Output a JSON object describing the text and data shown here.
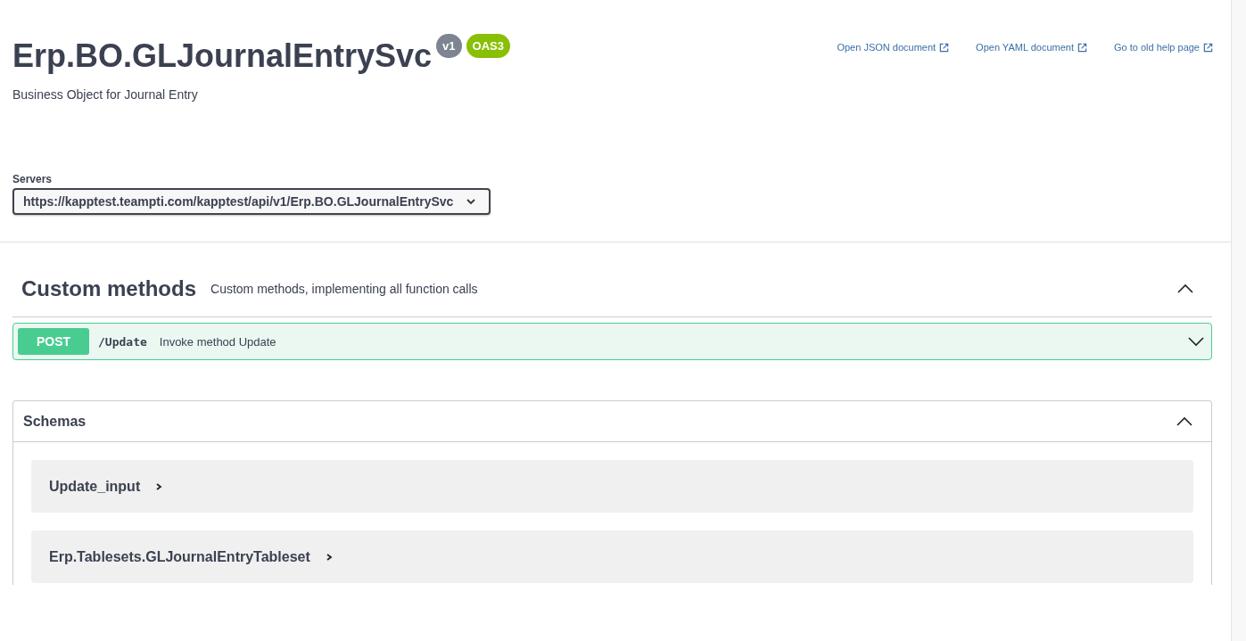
{
  "info": {
    "title": "Erp.BO.GLJournalEntrySvc",
    "version": "v1",
    "spec_badge": "OAS3",
    "description": "Business Object for Journal Entry"
  },
  "links": [
    {
      "label": "Open JSON document"
    },
    {
      "label": "Open YAML document"
    },
    {
      "label": "Go to old help page"
    }
  ],
  "servers": {
    "label": "Servers",
    "value": "https://kapptest.teampti.com/kapptest/api/v1/Erp.BO.GLJournalEntrySvc"
  },
  "tag_section": {
    "title": "Custom methods",
    "description": "Custom methods, implementing all function calls",
    "expanded": true,
    "operations": [
      {
        "method": "POST",
        "path": "/Update",
        "summary": "Invoke method Update",
        "expanded": false
      }
    ]
  },
  "schemas": {
    "title": "Schemas",
    "expanded": true,
    "models": [
      {
        "name": "Update_input",
        "expanded": false
      },
      {
        "name": "Erp.Tablesets.GLJournalEntryTableset",
        "expanded": false
      }
    ]
  }
}
